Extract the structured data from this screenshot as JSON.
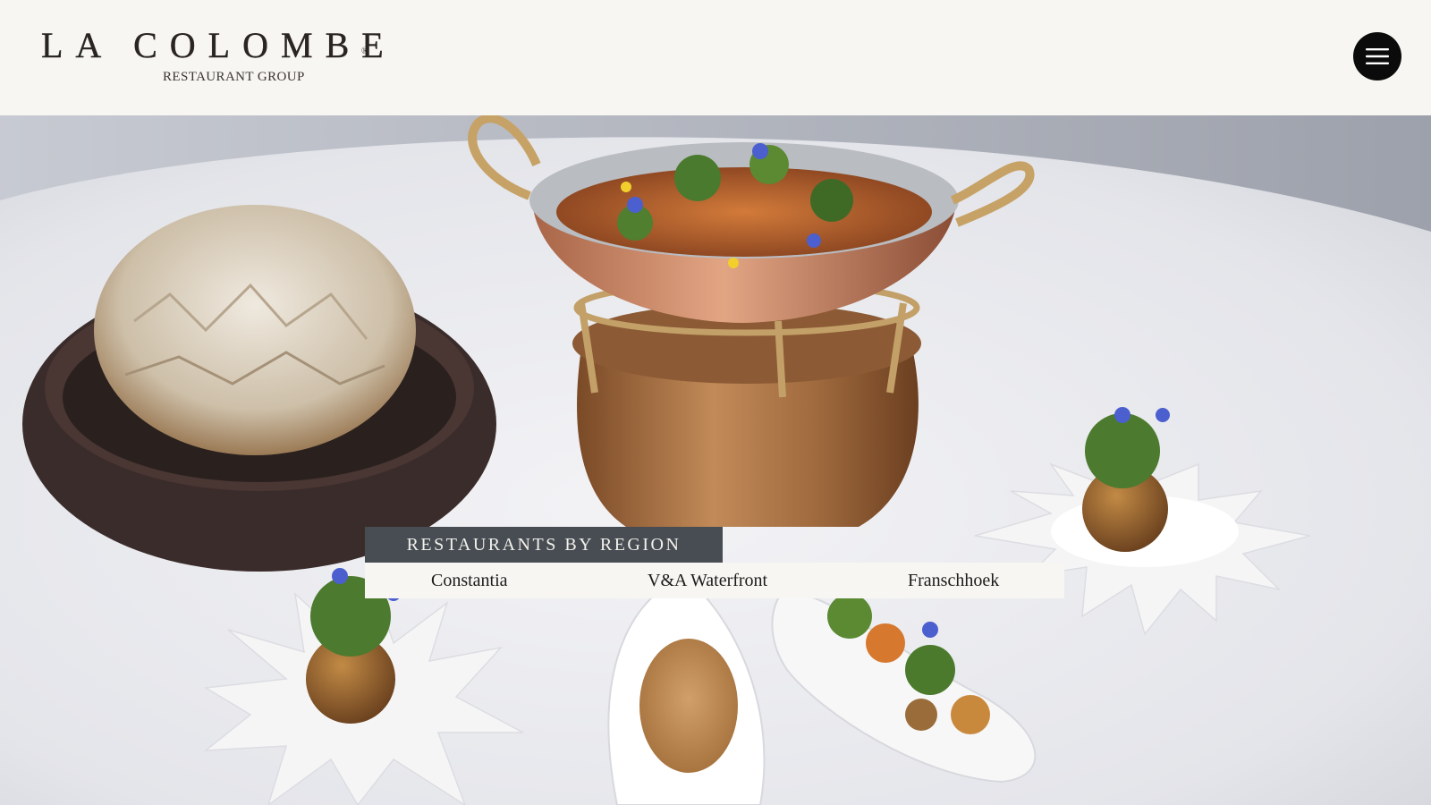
{
  "header": {
    "logo": {
      "name": "LA COLOMBE",
      "registered_mark": "®",
      "subtitle": "RESTAURANT GROUP"
    },
    "menu_button": {
      "icon": "hamburger-menu-icon"
    }
  },
  "hero": {
    "image": "plated-dishes-photo",
    "regions": {
      "title": "RESTAURANTS BY REGION",
      "links": [
        {
          "label": "Constantia"
        },
        {
          "label": "V&A Waterfront"
        },
        {
          "label": "Franschhoek"
        }
      ]
    }
  },
  "colors": {
    "header_bg": "#f7f6f3",
    "menu_button_bg": "#0b0b0b",
    "region_title_bg": "#474d53",
    "region_links_bg": "#f7f6f3"
  }
}
